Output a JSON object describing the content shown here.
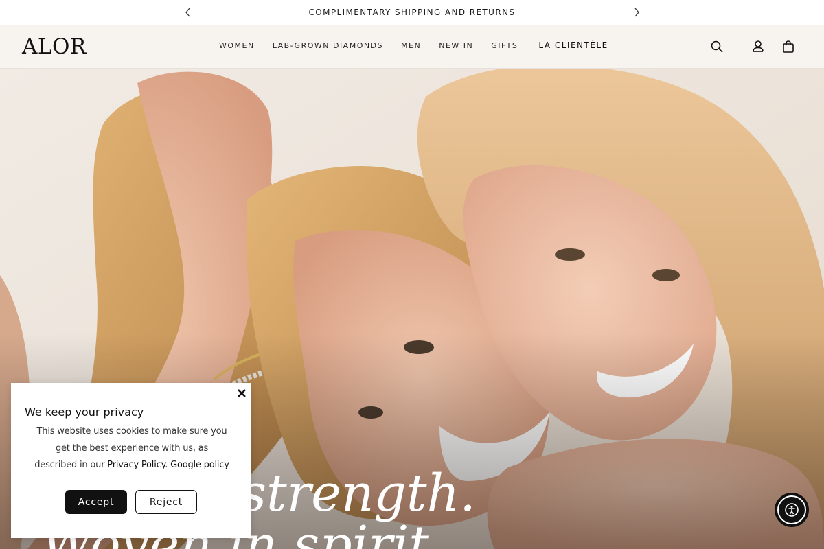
{
  "announcement": {
    "text": "COMPLIMENTARY SHIPPING AND RETURNS",
    "prev_icon": "chevron-left-icon",
    "next_icon": "chevron-right-icon"
  },
  "header": {
    "logo": "ALOR",
    "nav": [
      "WOMEN",
      "LAB-GROWN DIAMONDS",
      "MEN",
      "NEW IN",
      "GIFTS",
      "LA CLIENTÈLE"
    ],
    "icons": [
      "search-icon",
      "account-icon",
      "cart-icon"
    ]
  },
  "hero": {
    "line1": "strength.",
    "line2": "Woven in spirit"
  },
  "cookie": {
    "title": "We keep your privacy",
    "body": "This website uses cookies to make sure you get the best experience with us, as described in our",
    "privacy_link": "Privacy Policy.",
    "google_link": "Google policy",
    "accept_label": "Accept",
    "reject_label": "Reject"
  },
  "accessibility": {
    "icon": "accessibility-icon"
  },
  "colors": {
    "brand": "#111111",
    "header_bg": "#f7f4f0",
    "announce_bg": "#ffffff"
  }
}
